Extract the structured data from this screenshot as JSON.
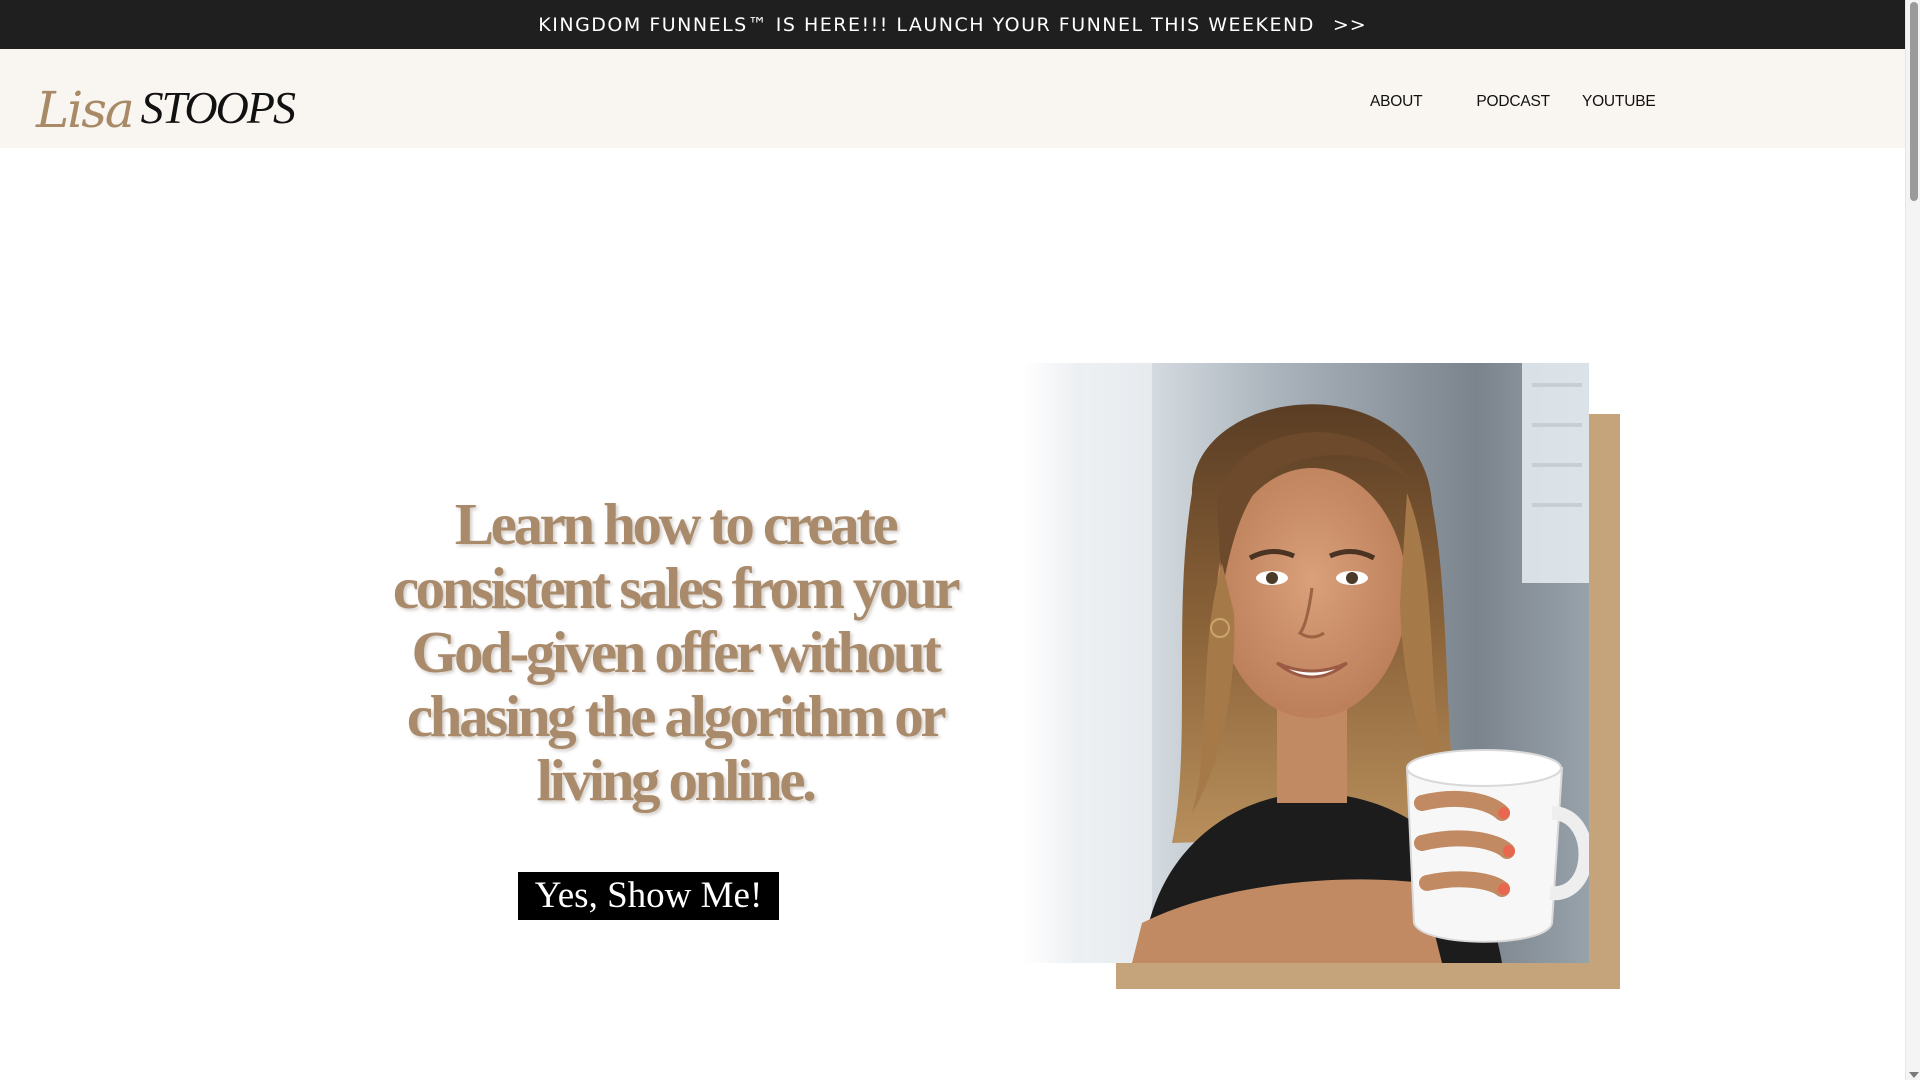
{
  "announcement": {
    "text": "KINGDOM FUNNELS™ IS HERE!!! LAUNCH YOUR FUNNEL THIS WEEKEND",
    "arrow": ">>"
  },
  "header": {
    "logo_script": "Lisa",
    "logo_caps": "STOOPS",
    "nav": [
      {
        "label": "ABOUT"
      },
      {
        "label": "PODCAST"
      },
      {
        "label": "YOUTUBE"
      }
    ]
  },
  "hero": {
    "headline": "Learn how to create consistent sales from your God-given offer without chasing the algorithm or living online.",
    "cta_label": "Yes, Show Me!"
  },
  "colors": {
    "announcement_bg": "#1f1f1f",
    "header_bg": "#f9f5f0",
    "accent_tan": "#c6a47b",
    "headline_color": "#a98b6b",
    "button_bg": "#000000"
  },
  "icons": {
    "announcement_arrow": "double-chevron-right",
    "scroll_down": "triangle-down"
  }
}
